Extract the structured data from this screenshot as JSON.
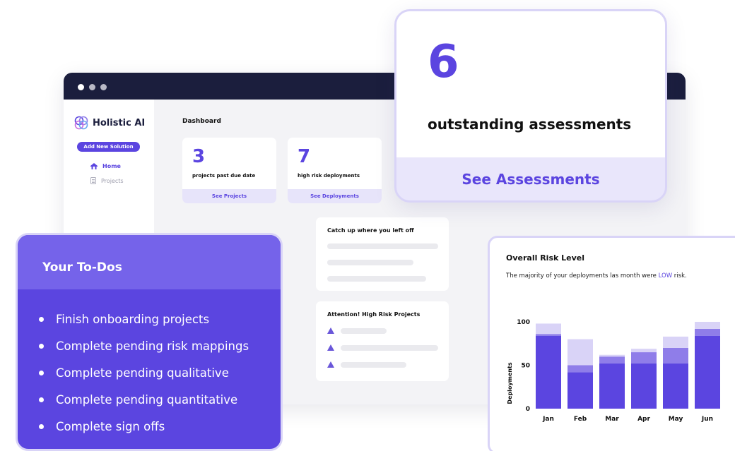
{
  "window": {
    "dot_colors": [
      "#ffffff",
      "#b9b9c6",
      "#b9b9c6"
    ]
  },
  "sidebar": {
    "logo_text": "Holistic AI",
    "add_button": "Add New Solution",
    "nav": [
      {
        "label": "Home",
        "icon": "home-icon",
        "active": true
      },
      {
        "label": "Projects",
        "icon": "document-icon",
        "active": false
      }
    ]
  },
  "dashboard": {
    "title": "Dashboard",
    "cards": [
      {
        "number": "3",
        "label": "projects past due date",
        "link": "See Projects"
      },
      {
        "number": "7",
        "label": "high risk deployments",
        "link": "See Deployments"
      }
    ],
    "catch_up_title": "Catch up where you left off",
    "attention_title": "Attention! High Risk Projects"
  },
  "assessments": {
    "number": "6",
    "label": "outstanding assessments",
    "link": "See Assessments"
  },
  "todos": {
    "title": "Your To-Dos",
    "items": [
      "Finish onboarding projects",
      "Complete pending risk mappings",
      "Complete pending qualitative",
      "Complete pending quantitative",
      "Complete sign offs"
    ]
  },
  "risk": {
    "title": "Overall Risk Level",
    "subtitle_before": "The majority of your deployments las month were ",
    "subtitle_highlight": "LOW",
    "subtitle_after": " risk."
  },
  "colors": {
    "accent": "#5b45e0",
    "mid": "#8f7de9",
    "light": "#d9d3f7",
    "dark_bar": "#1b1e3d"
  },
  "chart_data": {
    "type": "bar",
    "stacked": true,
    "categories": [
      "Jan",
      "Feb",
      "Mar",
      "Apr",
      "May",
      "Jun"
    ],
    "series": [
      {
        "values": [
          84,
          42,
          52,
          52,
          52,
          84
        ]
      },
      {
        "values": [
          2,
          8,
          8,
          13,
          18,
          8
        ]
      },
      {
        "values": [
          12,
          30,
          2,
          4,
          13,
          8
        ]
      }
    ],
    "ylabel": "Deployments",
    "yticks": [
      0,
      50,
      100
    ],
    "ylim": [
      0,
      100
    ],
    "grid": false
  }
}
